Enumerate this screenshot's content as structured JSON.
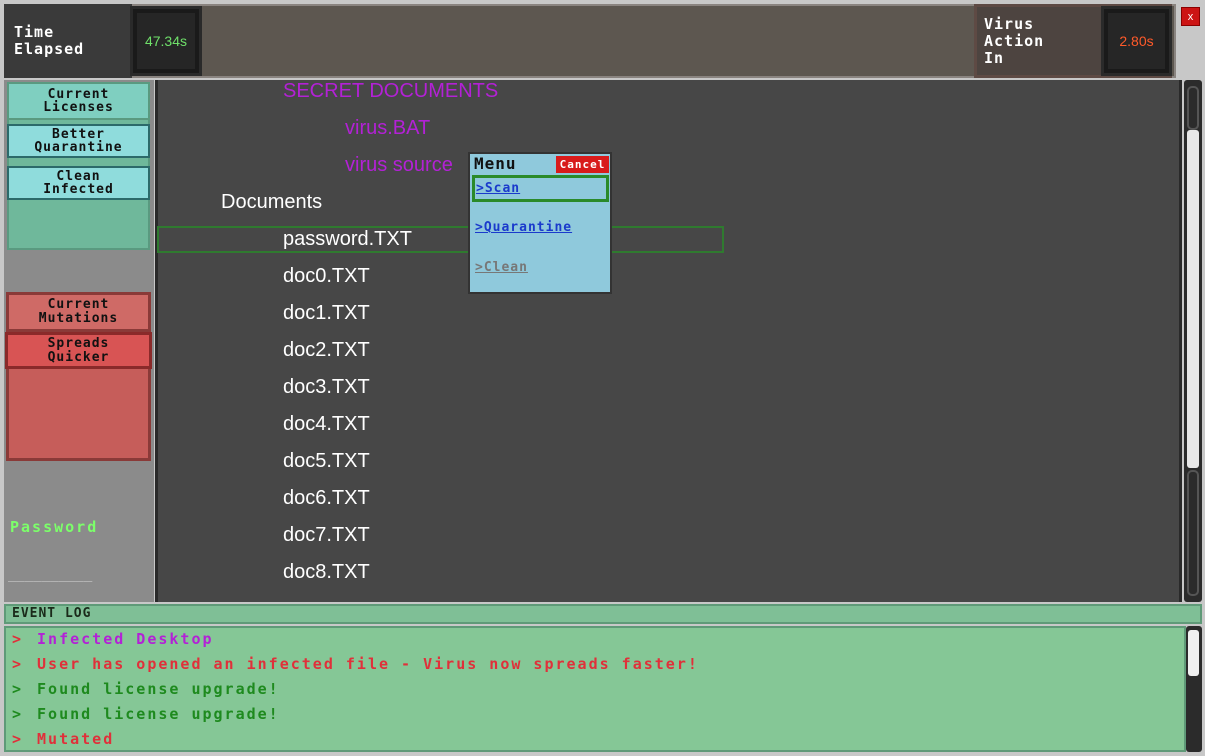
{
  "header": {
    "time_label_line1": "Time",
    "time_label_line2": "Elapsed",
    "time_value": "47.34s",
    "virus_label_line1": "Virus",
    "virus_label_line2": "Action",
    "virus_label_line3": "In",
    "virus_value": "2.80s",
    "close_label": "x"
  },
  "licenses": {
    "header_line1": "Current",
    "header_line2": "Licenses",
    "items": [
      {
        "line1": "Better",
        "line2": "Quarantine"
      },
      {
        "line1": "Clean",
        "line2": "Infected"
      }
    ]
  },
  "mutations": {
    "header_line1": "Current",
    "header_line2": "Mutations",
    "items": [
      {
        "line1": "Spreads",
        "line2": "Quicker"
      }
    ]
  },
  "password": {
    "label": "Password",
    "value": "__________"
  },
  "files": [
    {
      "name": "SECRET DOCUMENTS",
      "infected": true
    },
    {
      "name": "virus.BAT",
      "infected": true
    },
    {
      "name": "virus source",
      "infected": true
    },
    {
      "name": "Documents",
      "infected": false
    },
    {
      "name": "password.TXT",
      "infected": false,
      "selected": true
    },
    {
      "name": "doc0.TXT",
      "infected": false
    },
    {
      "name": "doc1.TXT",
      "infected": false
    },
    {
      "name": "doc2.TXT",
      "infected": false
    },
    {
      "name": "doc3.TXT",
      "infected": false
    },
    {
      "name": "doc4.TXT",
      "infected": false
    },
    {
      "name": "doc5.TXT",
      "infected": false
    },
    {
      "name": "doc6.TXT",
      "infected": false
    },
    {
      "name": "doc7.TXT",
      "infected": false
    },
    {
      "name": "doc8.TXT",
      "infected": false
    }
  ],
  "menu": {
    "title": "Menu",
    "cancel_label": "Cancel",
    "scan_label": ">Scan",
    "quarantine_label": ">Quarantine",
    "clean_label": ">Clean"
  },
  "event_log": {
    "title": "EVENT LOG",
    "entries": [
      {
        "text": "Infected Desktop",
        "color": "#b321d6"
      },
      {
        "text": "User has opened an infected file - Virus now spreads faster!",
        "color": "#e0303a"
      },
      {
        "text": "Found license upgrade!",
        "color": "#1e8a1e"
      },
      {
        "text": "Found license upgrade!",
        "color": "#1e8a1e"
      },
      {
        "text": "Mutated",
        "color": "#e0303a"
      }
    ]
  },
  "colors": {
    "infected_text": "#b321d6",
    "clean_text": "#ffffff",
    "menu_link": "#1a3acc",
    "menu_link_disabled": "#777777"
  }
}
